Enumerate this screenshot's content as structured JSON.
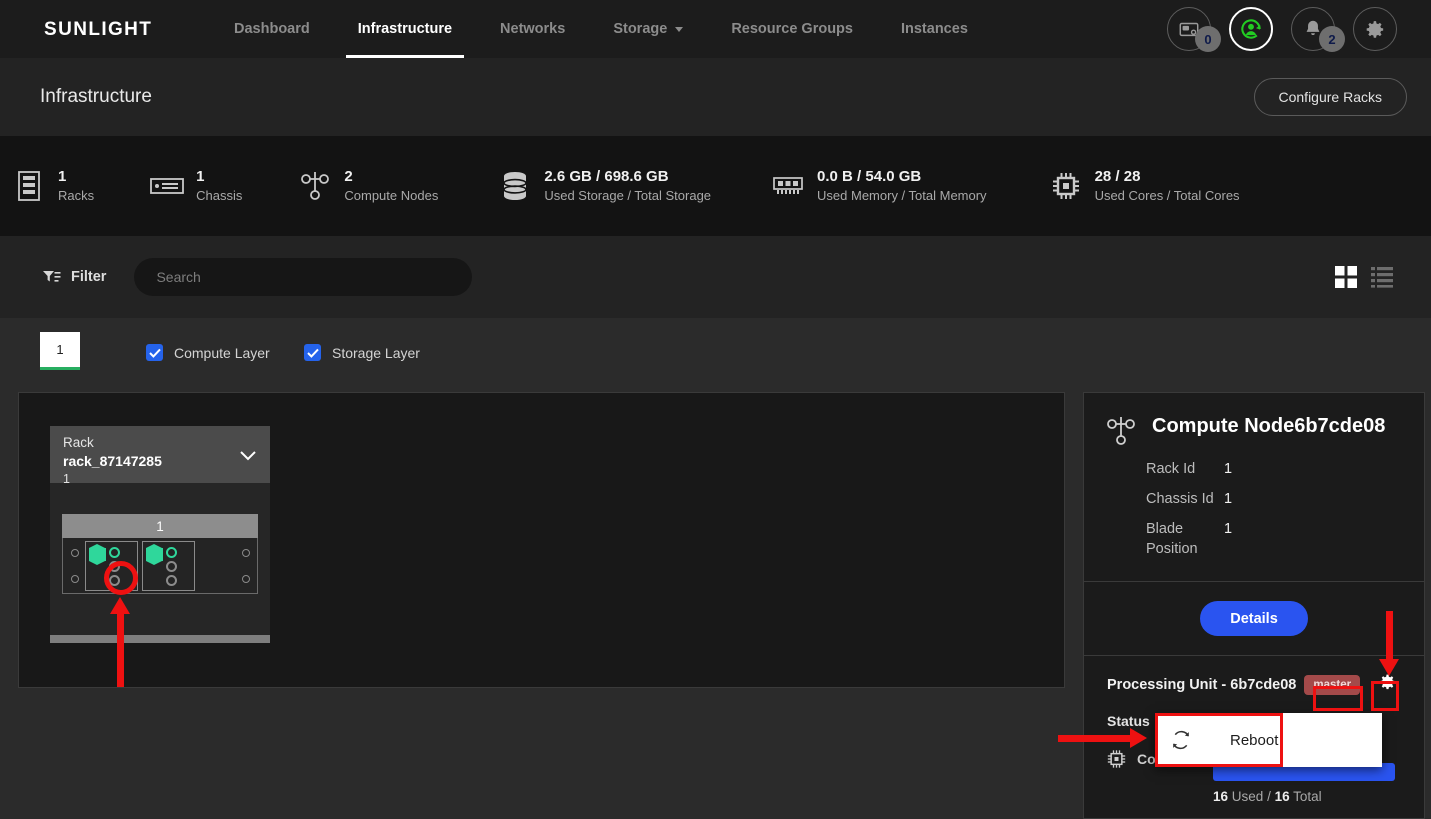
{
  "nav": {
    "logo": "SUNLIGHT",
    "items": [
      {
        "label": "Dashboard",
        "active": false,
        "caret": false
      },
      {
        "label": "Infrastructure",
        "active": true,
        "caret": false
      },
      {
        "label": "Networks",
        "active": false,
        "caret": false
      },
      {
        "label": "Storage",
        "active": false,
        "caret": true
      },
      {
        "label": "Resource Groups",
        "active": false,
        "caret": false
      },
      {
        "label": "Instances",
        "active": false,
        "caret": false
      }
    ],
    "actions": [
      {
        "icon": "sim-card-icon",
        "badge": "0"
      },
      {
        "icon": "user-sync-icon",
        "badge": null
      },
      {
        "icon": "bell-icon",
        "badge": "2"
      },
      {
        "icon": "gear-icon",
        "badge": null
      }
    ]
  },
  "page": {
    "title": "Infrastructure",
    "configure_button": "Configure Racks"
  },
  "stats": [
    {
      "icon": "rack-icon",
      "value": "1",
      "label": "Racks"
    },
    {
      "icon": "chassis-icon",
      "value": "1",
      "label": "Chassis"
    },
    {
      "icon": "node-icon",
      "value": "2",
      "label": "Compute Nodes"
    },
    {
      "icon": "storage-icon",
      "value": "2.6 GB / 698.6 GB",
      "label": "Used Storage / Total Storage"
    },
    {
      "icon": "memory-icon",
      "value": "0.0 B / 54.0 GB",
      "label": "Used Memory / Total Memory"
    },
    {
      "icon": "cpu-icon",
      "value": "28 / 28",
      "label": "Used Cores / Total Cores"
    }
  ],
  "toolbar": {
    "filter_label": "Filter",
    "search_placeholder": "Search",
    "search_value": "",
    "grid_view_active": true,
    "list_view_active": false
  },
  "layers": {
    "rack_tab": "1",
    "checkboxes": [
      {
        "label": "Compute Layer",
        "checked": true
      },
      {
        "label": "Storage Layer",
        "checked": true
      }
    ]
  },
  "rack": {
    "kicker": "Rack",
    "name": "rack_87147285",
    "index": "1",
    "chassis_label": "1",
    "blades": [
      {
        "selected": true,
        "hex_on": true,
        "dots": [
          true,
          false,
          false
        ]
      },
      {
        "selected": false,
        "hex_on": true,
        "dots": [
          true,
          false,
          false
        ]
      }
    ]
  },
  "detail": {
    "title": "Compute Node6b7cde08",
    "rows": [
      {
        "key": "Rack Id",
        "value": "1"
      },
      {
        "key": "Chassis Id",
        "value": "1"
      },
      {
        "key": "Blade Position",
        "value": "1"
      }
    ],
    "details_button": "Details",
    "processing_unit_title": "Processing Unit - 6b7cde08",
    "role_badge": "master",
    "status_label": "Status",
    "cores_label": "Cores",
    "cores_used": "16",
    "cores_used_suffix": "Used /",
    "cores_total": "16",
    "cores_total_suffix": "Total"
  },
  "dropdown": {
    "items": [
      {
        "icon": "refresh-icon",
        "label": "Reboot"
      }
    ]
  },
  "colors": {
    "accent_blue": "#2a54f0",
    "green": "#2fd79b",
    "tab_underline_green": "#27ae60",
    "annotation_red": "#ee1111",
    "badge_red": "#a44a4a"
  }
}
